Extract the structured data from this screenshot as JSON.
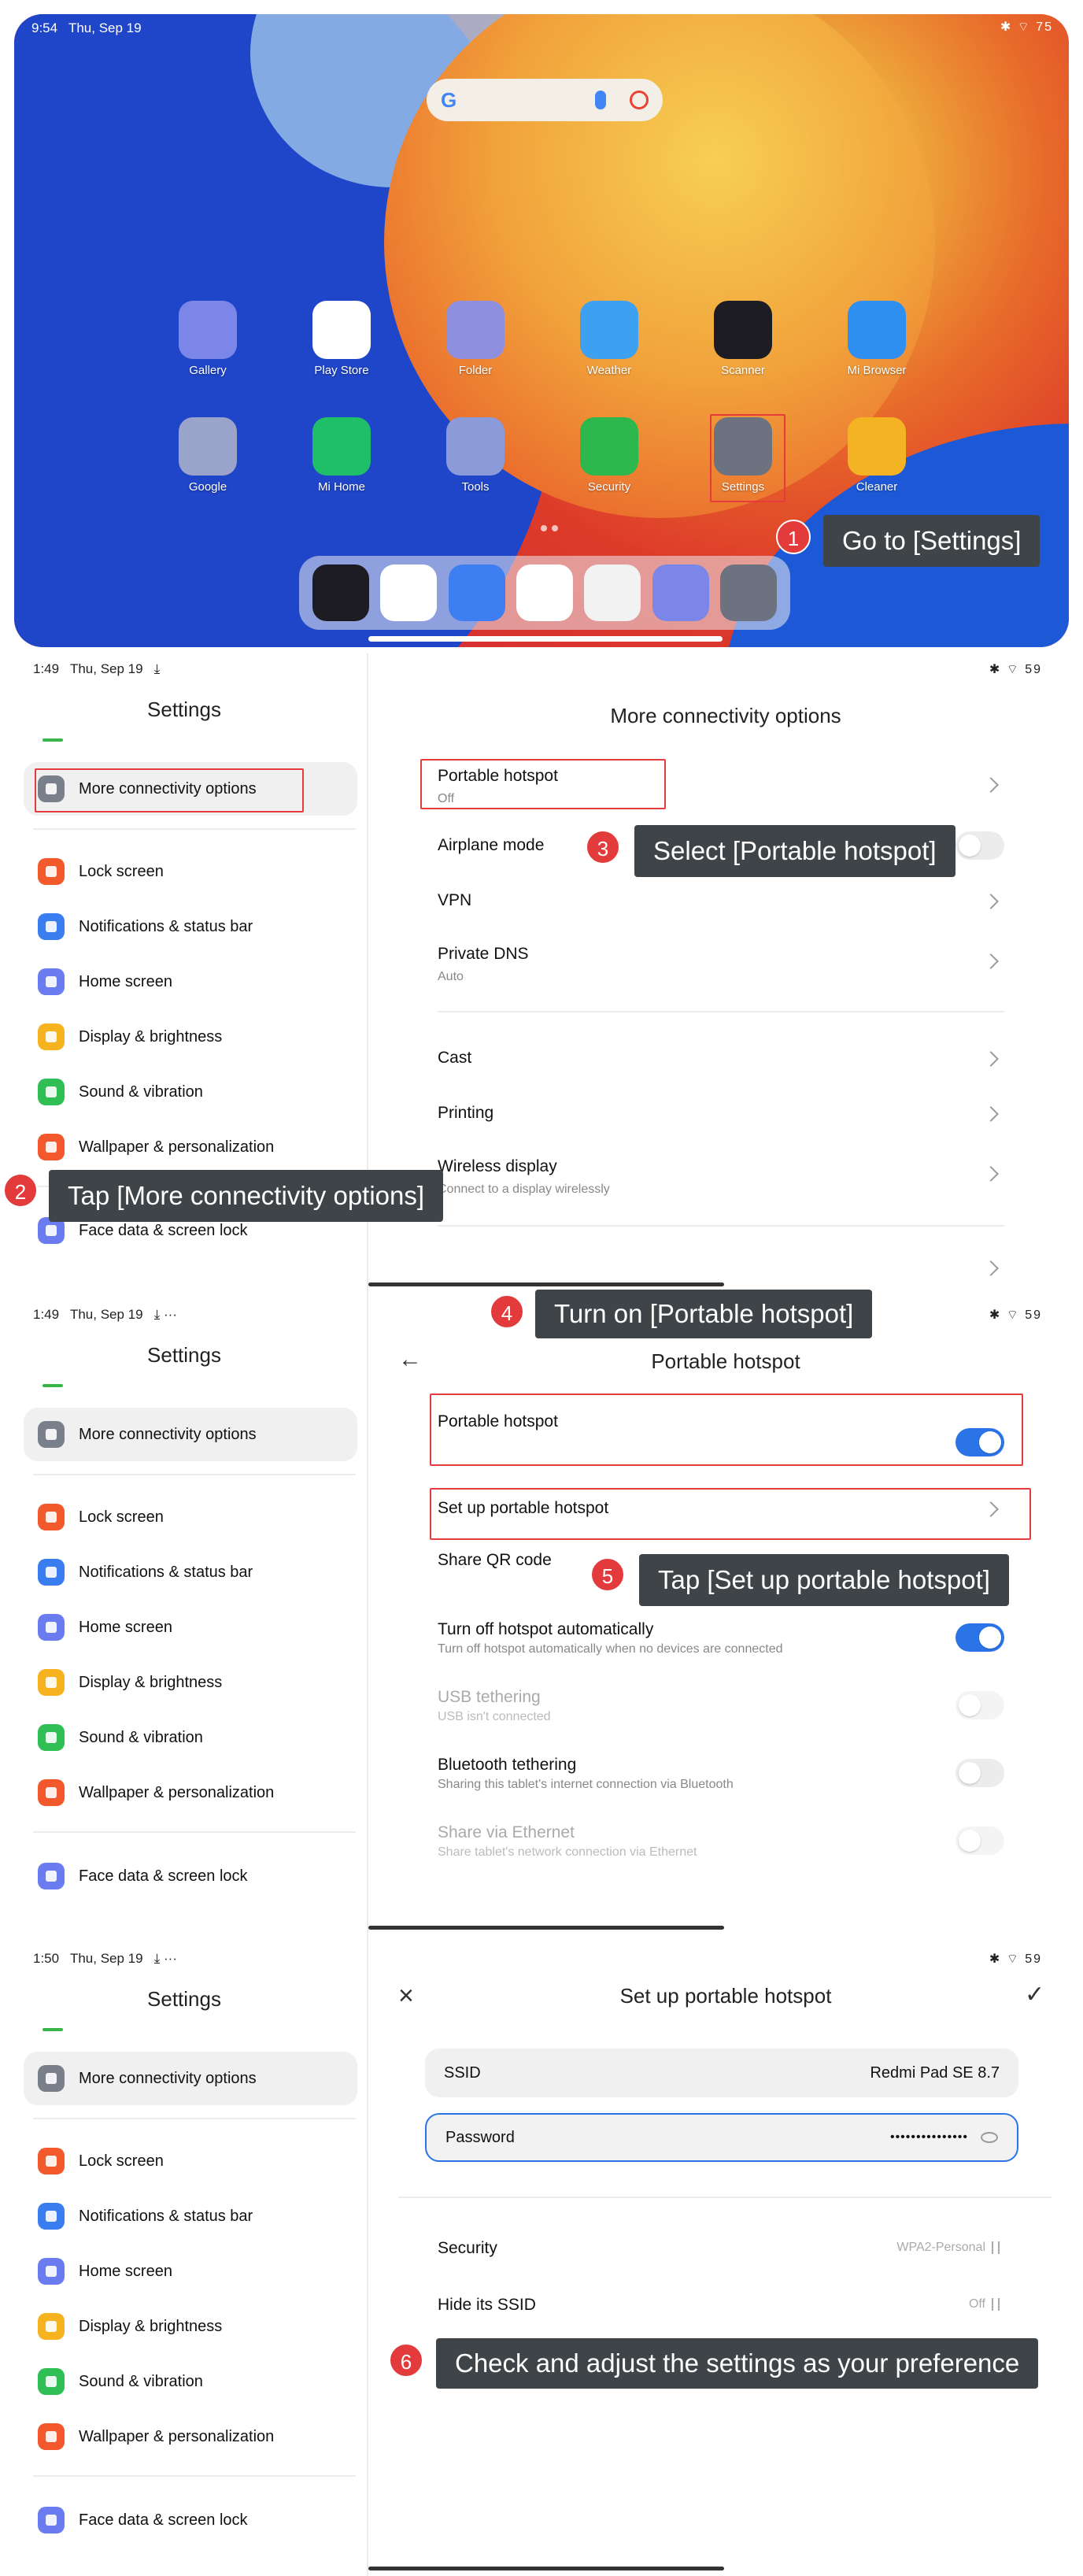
{
  "home": {
    "time": "9:54",
    "date": "Thu, Sep 19",
    "status_icons": "✱ ⌔ 75",
    "search_logo": "G",
    "row1": [
      {
        "label": "Gallery",
        "icon": "gallery-icon",
        "color": "#7b86e8"
      },
      {
        "label": "Play Store",
        "icon": "play-store-icon",
        "color": "#ffffff"
      },
      {
        "label": "Folder",
        "icon": "folder-icon",
        "color": "#8f8fe0"
      },
      {
        "label": "Weather",
        "icon": "weather-icon",
        "color": "#3ea0f0"
      },
      {
        "label": "Scanner",
        "icon": "scanner-icon",
        "color": "#1c1c22"
      },
      {
        "label": "Mi Browser",
        "icon": "mi-browser-icon",
        "color": "#2f8ff0"
      }
    ],
    "row2": [
      {
        "label": "Google",
        "icon": "google-folder-icon",
        "color": "#9aa3c9"
      },
      {
        "label": "Mi Home",
        "icon": "mi-home-icon",
        "color": "#1fbf6a"
      },
      {
        "label": "Tools",
        "icon": "tools-folder-icon",
        "color": "#8b9ad8"
      },
      {
        "label": "Security",
        "icon": "security-icon",
        "color": "#2cb84c"
      },
      {
        "label": "Settings",
        "icon": "settings-icon",
        "color": "#6d7280"
      },
      {
        "label": "Cleaner",
        "icon": "cleaner-icon",
        "color": "#f4b322"
      }
    ],
    "dock": [
      {
        "icon": "scanner-icon",
        "color": "#1c1c22"
      },
      {
        "icon": "chrome-icon",
        "color": "#ffffff"
      },
      {
        "icon": "messages-icon",
        "color": "#3d7ef0"
      },
      {
        "icon": "video-player-icon",
        "color": "#ffffff"
      },
      {
        "icon": "camera-icon",
        "color": "#f2f2f2"
      },
      {
        "icon": "gallery-icon",
        "color": "#7b86e8"
      },
      {
        "icon": "settings-icon",
        "color": "#6d7280"
      }
    ]
  },
  "steps": {
    "s1": {
      "num": "1",
      "text": "Go to [Settings]"
    },
    "s2": {
      "num": "2",
      "text": "Tap [More connectivity options]"
    },
    "s3": {
      "num": "3",
      "text": "Select [Portable hotspot]"
    },
    "s4": {
      "num": "4",
      "text": "Turn on [Portable hotspot]"
    },
    "s5": {
      "num": "5",
      "text": "Tap [Set up portable hotspot]"
    },
    "s6": {
      "num": "6",
      "text": "Check and adjust the settings as your preference"
    }
  },
  "sidebar": {
    "title": "Settings",
    "selected": {
      "label": "More connectivity options",
      "color": "#7a7f8c"
    },
    "items": [
      {
        "label": "Lock screen",
        "color": "#f25a2c"
      },
      {
        "label": "Notifications & status bar",
        "color": "#3a7df0"
      },
      {
        "label": "Home screen",
        "color": "#6b7cf0"
      },
      {
        "label": "Display & brightness",
        "color": "#f6b21f"
      },
      {
        "label": "Sound & vibration",
        "color": "#2fbf55"
      },
      {
        "label": "Wallpaper & personalization",
        "color": "#f2582c"
      }
    ],
    "face": {
      "label": "Face data & screen lock",
      "color": "#6b7cf0"
    }
  },
  "panel2": {
    "time": "1:49",
    "date": "Thu, Sep 19",
    "extra": "⤓",
    "status_right": "✱ ⌔ 59",
    "title": "More connectivity options",
    "rows": [
      {
        "title": "Portable hotspot",
        "sub": "Off"
      },
      {
        "title": "Airplane mode"
      },
      {
        "title": "VPN"
      },
      {
        "title": "Private DNS",
        "sub": "Auto"
      },
      {
        "title": "Cast"
      },
      {
        "title": "Printing"
      },
      {
        "title": "Wireless display",
        "sub": "Connect to a display wirelessly"
      }
    ]
  },
  "panel3": {
    "time": "1:49",
    "date": "Thu, Sep 19",
    "extra": "⤓ ···",
    "status_right": "✱ ⌔ 59",
    "title": "Portable hotspot",
    "rows": [
      {
        "title": "Portable hotspot"
      },
      {
        "title": "Set up portable hotspot"
      },
      {
        "title": "Share QR code"
      },
      {
        "title": "Turn off hotspot automatically",
        "sub": "Turn off hotspot automatically when no devices are connected"
      },
      {
        "title": "USB tethering",
        "sub": "USB isn't connected"
      },
      {
        "title": "Bluetooth tethering",
        "sub": "Sharing this tablet's internet connection via Bluetooth"
      },
      {
        "title": "Share via Ethernet",
        "sub": "Share tablet's network connection via Ethernet"
      }
    ]
  },
  "panel4": {
    "time": "1:50",
    "date": "Thu, Sep 19",
    "extra": "⤓ ···",
    "status_right": "✱ ⌔ 59",
    "title": "Set up portable hotspot",
    "ssid_label": "SSID",
    "ssid_value": "Redmi Pad SE 8.7",
    "password_label": "Password",
    "password_value": "•••••••••••••••",
    "security_label": "Security",
    "security_value": "WPA2-Personal",
    "hide_label": "Hide its SSID",
    "hide_value": "Off"
  },
  "colors": {
    "highlight": "#e63b3b",
    "callout": "#3f4448",
    "toggle_on": "#2b74e8"
  }
}
